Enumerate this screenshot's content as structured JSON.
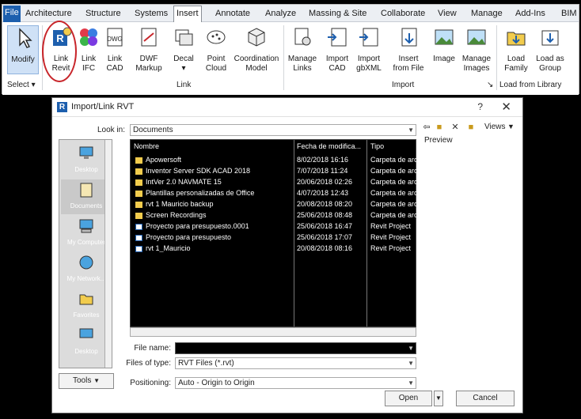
{
  "ribbon": {
    "tabs": [
      {
        "label": "File",
        "kind": "file"
      },
      {
        "label": "Architecture"
      },
      {
        "label": "Structure"
      },
      {
        "label": "Systems"
      },
      {
        "label": "Insert",
        "kind": "active"
      },
      {
        "label": "Annotate"
      },
      {
        "label": "Analyze"
      },
      {
        "label": "Massing & Site"
      },
      {
        "label": "Collaborate"
      },
      {
        "label": "View"
      },
      {
        "label": "Manage"
      },
      {
        "label": "Add-Ins"
      },
      {
        "label": "BIM"
      }
    ],
    "tools": [
      {
        "label": "Modify",
        "icon": "cursor-arrow-icon"
      },
      {
        "label": "Link\nRevit",
        "icon": "link-revit-icon"
      },
      {
        "label": "Link\nIFC",
        "icon": "link-ifc-icon"
      },
      {
        "label": "Link\nCAD",
        "icon": "link-cad-icon"
      },
      {
        "label": "DWF\nMarkup",
        "icon": "dwf-markup-icon"
      },
      {
        "label": "Decal\n▾",
        "icon": "decal-icon"
      },
      {
        "label": "Point\nCloud",
        "icon": "point-cloud-icon"
      },
      {
        "label": "Coordination\nModel",
        "icon": "coordination-model-icon"
      },
      {
        "label": "Manage\nLinks",
        "icon": "manage-links-icon"
      },
      {
        "label": "Import\nCAD",
        "icon": "import-cad-icon"
      },
      {
        "label": "Import\ngbXML",
        "icon": "import-gbxml-icon"
      },
      {
        "label": "Insert\nfrom File",
        "icon": "insert-from-file-icon"
      },
      {
        "label": "Image",
        "icon": "image-icon"
      },
      {
        "label": "Manage\nImages",
        "icon": "manage-images-icon"
      },
      {
        "label": "Load\nFamily",
        "icon": "load-family-icon"
      },
      {
        "label": "Load as\nGroup",
        "icon": "load-as-group-icon"
      }
    ],
    "panels": {
      "select": "Select ▾",
      "link": "Link",
      "import": "Import",
      "import_arrow": "↘",
      "load": "Load from Library"
    }
  },
  "dialog": {
    "title": "Import/Link RVT",
    "help": "?",
    "close": "✕",
    "look_in_label": "Look in:",
    "look_in_value": "Documents",
    "toolbar": {
      "views_label": "Views",
      "preview_label": "Preview"
    },
    "places": [
      {
        "label": "Desktop",
        "icon": "desktop-icon"
      },
      {
        "label": "Documents",
        "icon": "documents-icon"
      },
      {
        "label": "My Computer",
        "icon": "my-computer-icon"
      },
      {
        "label": "My Network...",
        "icon": "network-icon"
      },
      {
        "label": "Favorites",
        "icon": "favorites-folder-icon"
      },
      {
        "label": "Desktop",
        "icon": "desktop-icon"
      }
    ],
    "columns": {
      "name": "Nombre",
      "date": "Fecha de modifica...",
      "type": "Tipo"
    },
    "files": [
      {
        "name": "Apowersoft",
        "date": "8/02/2018 16:16",
        "type": "Carpeta de arc",
        "kind": "folder"
      },
      {
        "name": "Inventor Server SDK ACAD 2018",
        "date": "7/07/2018 11:24",
        "type": "Carpeta de arc",
        "kind": "folder"
      },
      {
        "name": "IntVer 2.0 NAVMATE 15",
        "date": "20/06/2018 02:26",
        "type": "Carpeta de arc",
        "kind": "folder"
      },
      {
        "name": "Plantillas personalizadas de Office",
        "date": "4/07/2018 12:43",
        "type": "Carpeta de arc",
        "kind": "folder"
      },
      {
        "name": "rvt 1 Mauricio backup",
        "date": "20/08/2018 08:20",
        "type": "Carpeta de arc",
        "kind": "folder"
      },
      {
        "name": "Screen Recordings",
        "date": "25/06/2018 08:48",
        "type": "Carpeta de arc",
        "kind": "folder"
      },
      {
        "name": "Proyecto para presupuesto.0001",
        "date": "25/06/2018 16:47",
        "type": "Revit Project",
        "kind": "rvt"
      },
      {
        "name": "Proyecto para presupuesto",
        "date": "25/06/2018 17:07",
        "type": "Revit Project",
        "kind": "rvt"
      },
      {
        "name": "rvt 1_Mauricio",
        "date": "20/08/2018 08:16",
        "type": "Revit Project",
        "kind": "rvt"
      }
    ],
    "file_name_label": "File name:",
    "file_name_value": "",
    "files_of_type_label": "Files of type:",
    "files_of_type_value": "RVT Files (*.rvt)",
    "positioning_label": "Positioning:",
    "positioning_value": "Auto - Origin to Origin",
    "tools_label": "Tools",
    "open_label": "Open",
    "cancel_label": "Cancel"
  },
  "colors": {
    "accent": "#1d5fae",
    "highlight_circle": "#c8262b",
    "folder": "#f2cc4d"
  }
}
